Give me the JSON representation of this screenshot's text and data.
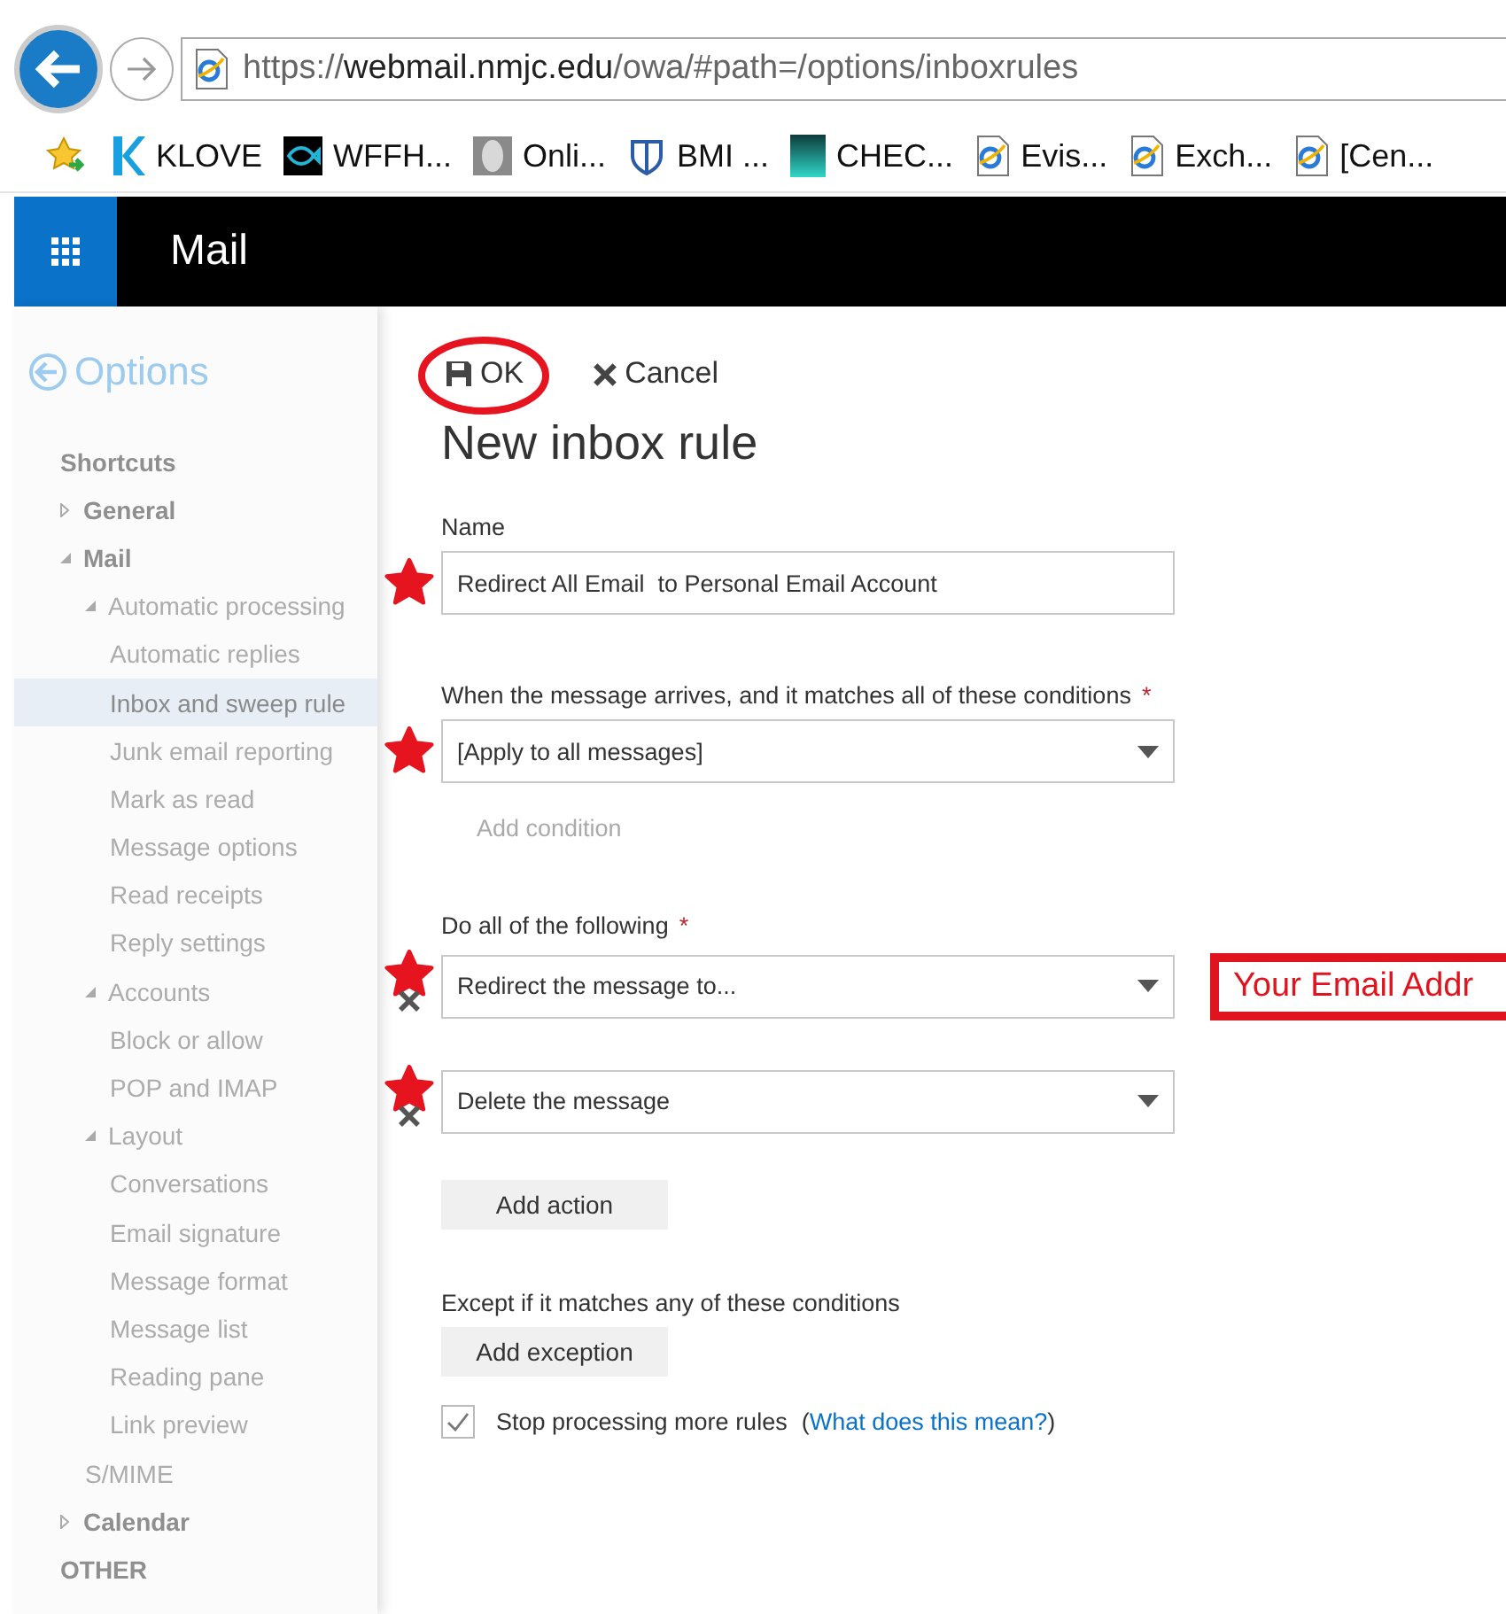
{
  "browser": {
    "address": "https://**webmail.nmjc.edu**/owa/#path=/options/inboxrules"
  },
  "favorites": [
    {
      "label": "KLOVE",
      "kind": "logo"
    },
    {
      "label": "WFFH...",
      "kind": "fish"
    },
    {
      "label": "Onli...",
      "kind": "mask"
    },
    {
      "label": "BMI ...",
      "kind": "shield"
    },
    {
      "label": "CHEC...",
      "kind": "bars"
    },
    {
      "label": "Evis...",
      "kind": "page"
    },
    {
      "label": "Exch...",
      "kind": "page"
    },
    {
      "label": "[Cen...",
      "kind": "page"
    }
  ],
  "app_bar": {
    "title": "Mail"
  },
  "sidebar": {
    "back_label": "Options",
    "items": [
      {
        "label": "Shortcuts",
        "selected": false
      },
      {
        "label": "General",
        "expanded": false,
        "selected": false
      },
      {
        "label": "Mail",
        "expanded": true,
        "selected": false,
        "children": [
          {
            "label": "Automatic processing",
            "expanded": true,
            "selected": false,
            "children": [
              {
                "label": "Automatic replies",
                "selected": false
              },
              {
                "label": "Inbox and sweep rule",
                "selected": true
              },
              {
                "label": "Junk email reporting",
                "selected": false
              },
              {
                "label": "Mark as read",
                "selected": false
              },
              {
                "label": "Message options",
                "selected": false
              },
              {
                "label": "Read receipts",
                "selected": false
              },
              {
                "label": "Reply settings",
                "selected": false
              }
            ]
          },
          {
            "label": "Accounts",
            "expanded": true,
            "selected": false,
            "children": [
              {
                "label": "Block or allow",
                "selected": false
              },
              {
                "label": "POP and IMAP",
                "selected": false
              }
            ]
          },
          {
            "label": "Layout",
            "expanded": true,
            "selected": false,
            "children": [
              {
                "label": "Conversations",
                "selected": false
              },
              {
                "label": "Email signature",
                "selected": false
              },
              {
                "label": "Message format",
                "selected": false
              },
              {
                "label": "Message list",
                "selected": false
              },
              {
                "label": "Reading pane",
                "selected": false
              },
              {
                "label": "Link preview",
                "selected": false
              }
            ]
          },
          {
            "label": "S/MIME",
            "selected": false
          }
        ]
      },
      {
        "label": "Calendar",
        "expanded": false,
        "selected": false
      },
      {
        "label": "OTHER",
        "selected": false
      }
    ]
  },
  "form": {
    "toolbar": [
      {
        "label": "OK",
        "kind": "save",
        "circled": true
      },
      {
        "label": "Cancel",
        "kind": "cancel",
        "circled": false
      }
    ],
    "title": "New inbox rule",
    "name": {
      "label": "Name",
      "value": "Redirect All Email  to Personal Email Account",
      "starred": true
    },
    "conditions": {
      "label": "When the message arrives, and it matches all of these conditions",
      "required_mark": "*",
      "value": "[Apply to all messages]",
      "starred": true,
      "add_link": "Add condition"
    },
    "actions": {
      "label": "Do all of the following",
      "required_mark": "*",
      "rows": [
        {
          "value": "Redirect the message to...",
          "starred": true,
          "callout": "Your Email Addr"
        },
        {
          "value": "Delete the message",
          "starred": true
        }
      ],
      "add_button": "Add action"
    },
    "exceptions": {
      "label": "Except if it matches any of these conditions",
      "add_button": "Add exception"
    },
    "stop_processing": {
      "label": "Stop processing more rules",
      "checked": true,
      "help_open": "(",
      "help_link": "What does this mean?",
      "help_close": ")"
    }
  }
}
